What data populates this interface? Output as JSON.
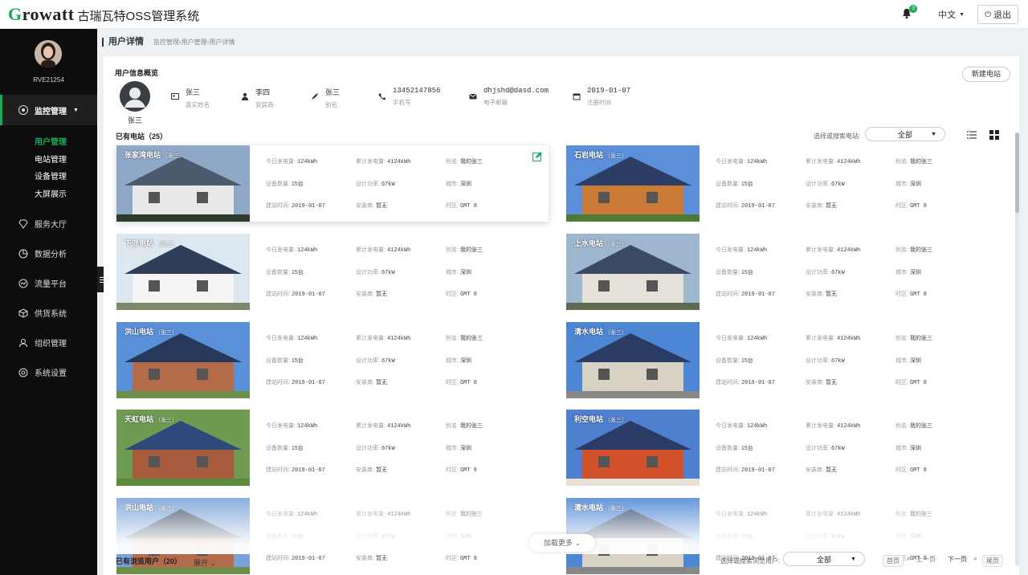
{
  "header": {
    "logo_text": "Growatt",
    "app_title": "古瑞瓦特OSS管理系统",
    "notification_count": "3",
    "language": "中文",
    "logout_label": "退出"
  },
  "sidebar": {
    "user_code": "RVE21254",
    "active_menu": "监控管理",
    "sub_items": [
      "用户管理",
      "电站管理",
      "设备管理",
      "大屏展示"
    ],
    "items": [
      "服务大厅",
      "数据分析",
      "流量平台",
      "供货系统",
      "组织管理",
      "系统设置"
    ]
  },
  "breadcrumb": {
    "title": "用户详情",
    "path": "监控管理›用户管理›用户详情"
  },
  "profile": {
    "section_title": "用户信息概览",
    "name": "张三",
    "new_station_label": "新建电站",
    "fields": [
      {
        "value": "张三",
        "label": "真实姓名"
      },
      {
        "value": "李四",
        "label": "安装商"
      },
      {
        "value": "张三",
        "label": "别名"
      },
      {
        "value": "13452147856",
        "label": "手机号"
      },
      {
        "value": "dhjshd@dasd.com",
        "label": "电子邮箱"
      },
      {
        "value": "2019-01-07",
        "label": "注册时间"
      }
    ]
  },
  "stations": {
    "section_title": "已有电站（25）",
    "search_label": "选择或搜索电站:",
    "filter_value": "全部",
    "labels": {
      "today": "今日发电量:",
      "total": "累计发电量:",
      "alias": "别名:",
      "count": "设备数量:",
      "power": "设计功率:",
      "city": "城市:",
      "built": "建站时间:",
      "installer": "安装商:",
      "tz": "时区:"
    },
    "common": {
      "today": "124kWh",
      "total": "4124kWh",
      "alias": "我的张三",
      "count": "15台",
      "power": "67kW",
      "city": "深圳",
      "built": "2019-01-07",
      "installer": "暂无",
      "tz": "GMT 8"
    },
    "owner_tag": "（张三）",
    "names": [
      "张家湾电站",
      "石岩电站",
      "下派电站",
      "上水电站",
      "洪山电站",
      "清水电站",
      "天虹电站",
      "利空电站",
      "洪山电站",
      "清水电站"
    ],
    "load_more_label": "加载更多"
  },
  "viewers": {
    "section_title": "已有浏览用户（20）",
    "expand_label": "展开",
    "search_label": "选择或搜索浏览用户:",
    "filter_value": "全部",
    "pager": {
      "first": "首页",
      "prev": "上一页",
      "next": "下一页",
      "last": "尾页"
    }
  }
}
